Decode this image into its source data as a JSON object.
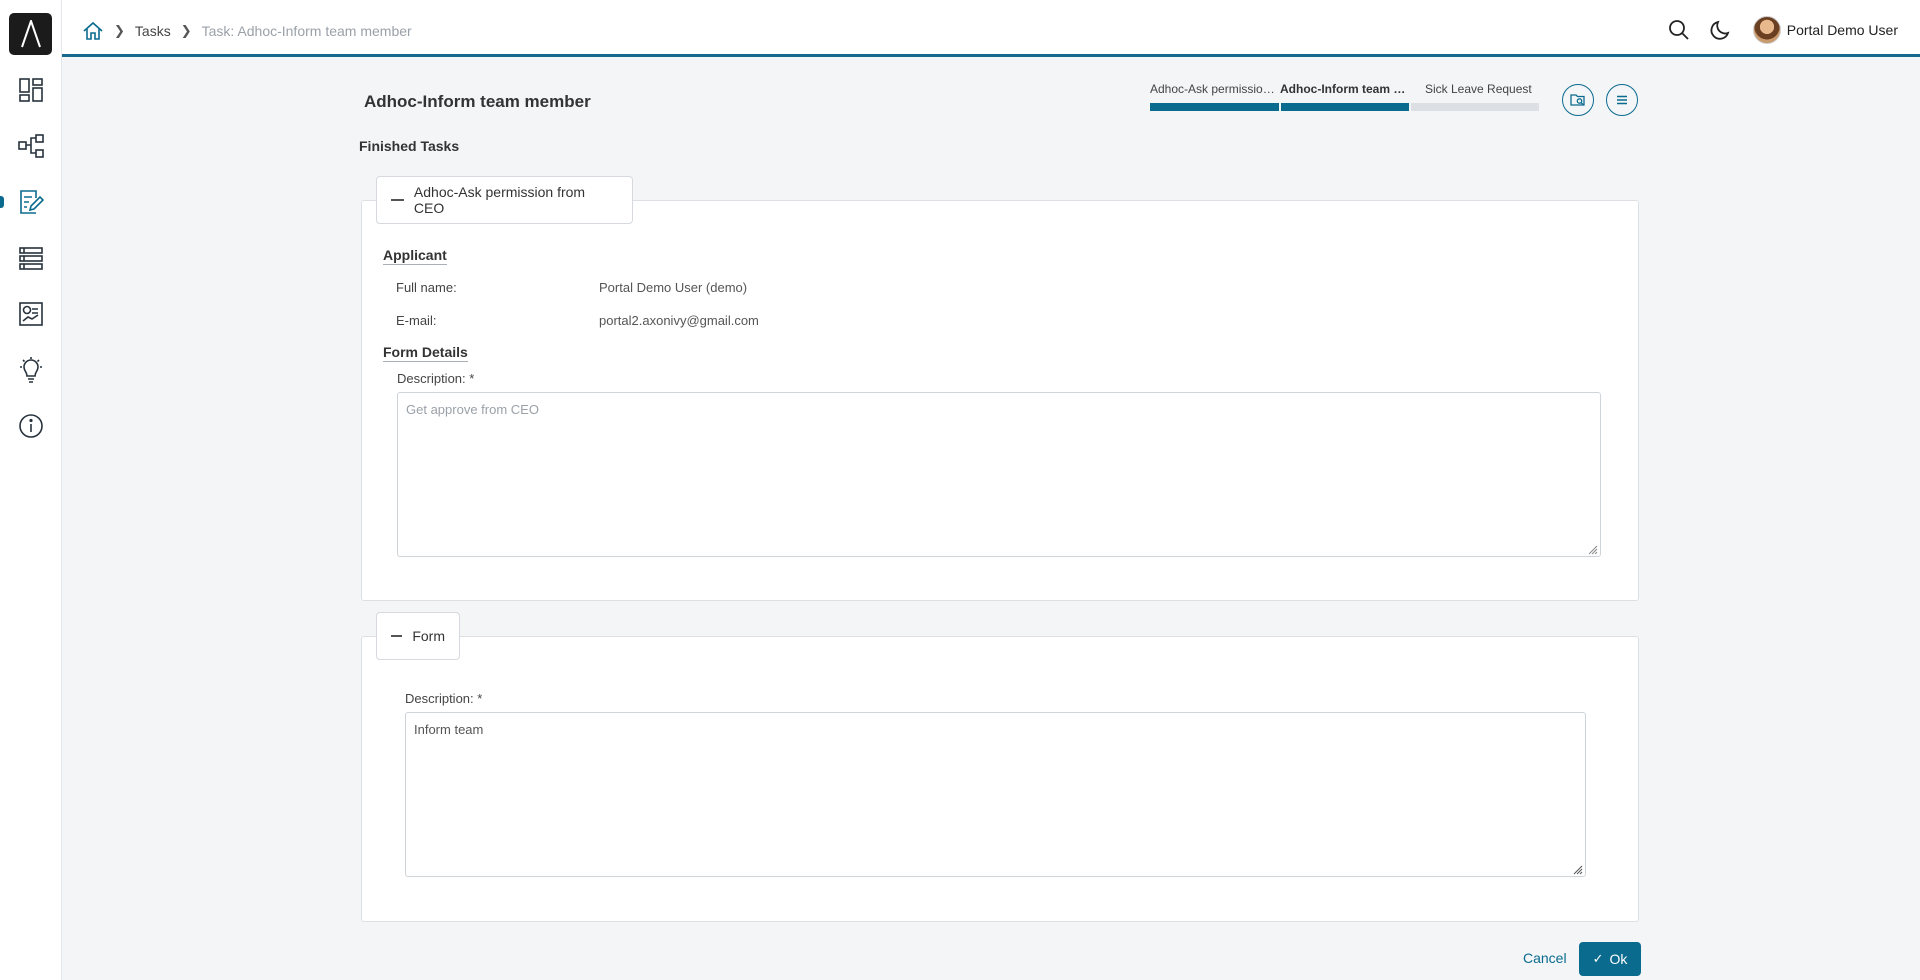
{
  "sidebar": {
    "logo": "logo-icon",
    "items": [
      {
        "name": "dashboard",
        "icon": "dashboard-icon"
      },
      {
        "name": "processes",
        "icon": "process-tree-icon"
      },
      {
        "name": "tasks",
        "icon": "task-edit-icon",
        "active": true
      },
      {
        "name": "cases",
        "icon": "list-icon"
      },
      {
        "name": "statistics",
        "icon": "statistics-icon"
      },
      {
        "name": "showcase",
        "icon": "lightbulb-icon"
      },
      {
        "name": "about",
        "icon": "info-icon"
      }
    ]
  },
  "breadcrumb": {
    "home_icon": "home-icon",
    "items": [
      "Tasks",
      "Task: Adhoc-Inform team member"
    ]
  },
  "header": {
    "search_icon": "search-icon",
    "theme_icon": "moon-icon",
    "username": "Portal Demo User"
  },
  "page": {
    "title": "Adhoc-Inform team member",
    "finished_tasks_label": "Finished Tasks"
  },
  "stepper": {
    "steps": [
      {
        "label": "Adhoc-Ask permission from CEO",
        "status": "done"
      },
      {
        "label": "Adhoc-Inform team member",
        "status": "current"
      },
      {
        "label": "Sick Leave Request",
        "status": "pending"
      }
    ],
    "colors": {
      "done": "#0b6b8f",
      "pending": "#dcdfe3"
    }
  },
  "finished_task": {
    "legend": "Adhoc-Ask permission from CEO",
    "applicant_heading": "Applicant",
    "full_name_label": "Full name:",
    "full_name_value": "Portal Demo User (demo)",
    "email_label": "E-mail:",
    "email_value": "portal2.axonivy@gmail.com",
    "form_details_heading": "Form Details",
    "description_label": "Description: *",
    "description_value": "Get approve from CEO"
  },
  "form": {
    "legend": "Form",
    "description_label": "Description: *",
    "description_value": "Inform team"
  },
  "actions": {
    "cancel": "Cancel",
    "ok": "Ok"
  },
  "colors": {
    "accent": "#0b6b8f",
    "sidebar_active": "#0b6b8f",
    "background": "#f3f5f7"
  }
}
